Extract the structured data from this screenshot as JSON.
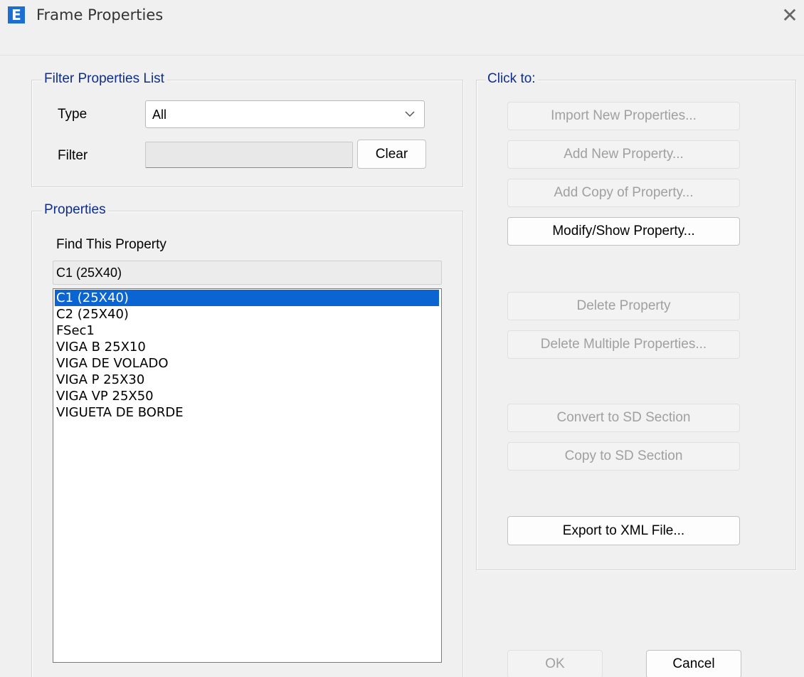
{
  "window": {
    "title": "Frame Properties",
    "app_icon_letter": "E",
    "close_glyph": "✕"
  },
  "filter_group": {
    "label": "Filter Properties List",
    "type_label": "Type",
    "type_value": "All",
    "filter_label": "Filter",
    "filter_value": "",
    "clear_button": "Clear"
  },
  "properties_group": {
    "label": "Properties",
    "find_label": "Find This Property",
    "find_value": "C1 (25X40)",
    "items": [
      "C1 (25X40)",
      "C2 (25X40)",
      "FSec1",
      "VIGA B 25X10",
      "VIGA DE VOLADO",
      "VIGA P 25X30",
      "VIGA VP 25X50",
      "VIGUETA DE BORDE"
    ],
    "selected_index": 0
  },
  "click_to_group": {
    "label": "Click to:",
    "import_button": "Import New Properties...",
    "add_new_button": "Add New Property...",
    "add_copy_button": "Add Copy of Property...",
    "modify_button": "Modify/Show Property...",
    "delete_button": "Delete Property",
    "delete_multiple_button": "Delete Multiple Properties...",
    "convert_button": "Convert to SD Section",
    "copy_sd_button": "Copy to SD Section",
    "export_button": "Export to XML File..."
  },
  "footer": {
    "ok_button": "OK",
    "cancel_button": "Cancel"
  },
  "colors": {
    "group_label": "#0f2d8a",
    "selection": "#0a64d2",
    "icon_bg": "#1c6fd1",
    "disabled_text": "#a0a0a0"
  }
}
